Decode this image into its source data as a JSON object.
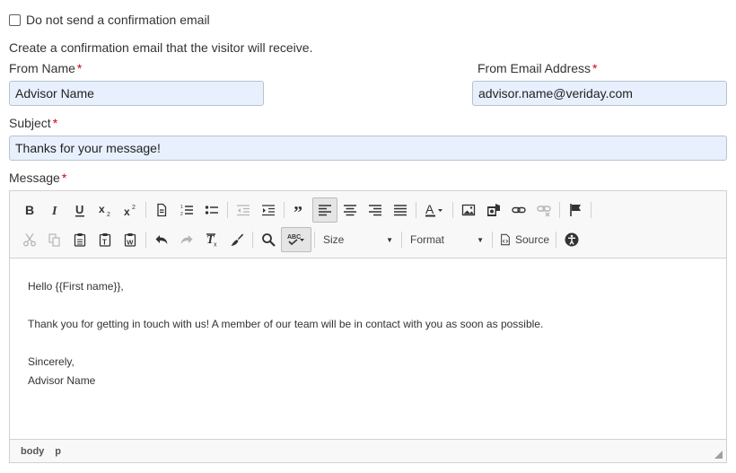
{
  "checkbox": {
    "label": "Do not send a confirmation email",
    "checked": false
  },
  "intro_text": "Create a confirmation email that the visitor will receive.",
  "required_mark": "*",
  "from_name": {
    "label": "From Name",
    "value": "Advisor Name"
  },
  "from_email": {
    "label": "From Email Address",
    "value": "advisor.name@veriday.com"
  },
  "subject": {
    "label": "Subject",
    "value": "Thanks for your message!"
  },
  "message": {
    "label": "Message",
    "toolbar": {
      "size_label": "Size",
      "format_label": "Format",
      "source_label": "Source"
    },
    "body": {
      "greeting": "Hello {{First name}},",
      "line1": "Thank you for getting in touch with us! A member of our team will be in contact with you as soon as possible.",
      "signoff": "Sincerely,",
      "signature": "Advisor Name"
    },
    "statusbar": {
      "path1": "body",
      "path2": "p"
    }
  },
  "colors": {
    "field_bg": "#e8f0fe",
    "field_border": "#b7c3cf",
    "required": "#d0021b",
    "toolbar_bg": "#f8f8f8"
  }
}
